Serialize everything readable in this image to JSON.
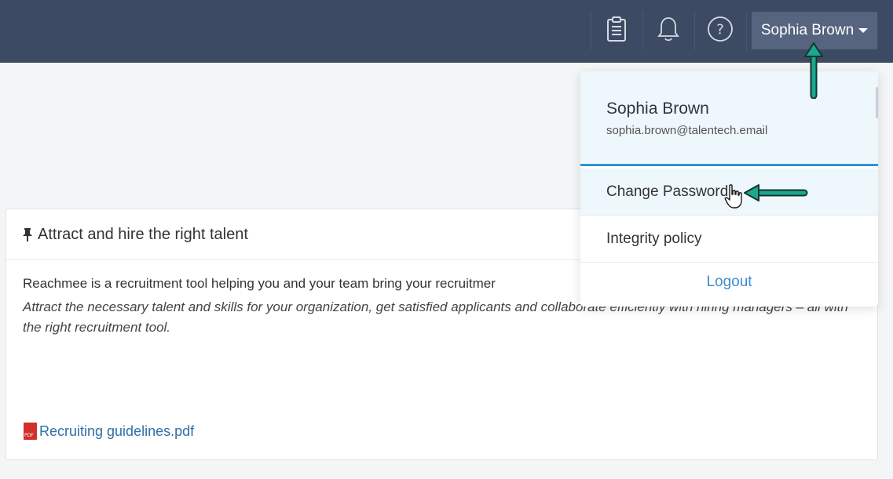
{
  "navbar": {
    "icons": [
      "clipboard-icon",
      "bell-icon",
      "help-icon"
    ],
    "user_name": "Sophia Brown"
  },
  "content": {
    "title": "Attract and hire the right talent",
    "description": "Reachmee is a recruitment tool helping you and your team bring your recruitmer",
    "tagline": "Attract the necessary talent and skills for your organization, get satisfied applicants and collaborate efficiently with hiring managers – all with the right recruitment tool.",
    "attachment": "Recruiting guidelines.pdf"
  },
  "dropdown": {
    "name": "Sophia Brown",
    "email": "sophia.brown@talentech.email",
    "items": [
      {
        "label": "Change Password"
      },
      {
        "label": "Integrity policy"
      }
    ],
    "logout": "Logout"
  },
  "colors": {
    "navbar": "#3d4a63",
    "user_button": "#56647f",
    "accent": "#2f95d3",
    "link": "#2f6fa8",
    "annotation_arrow": "#1aa890"
  }
}
